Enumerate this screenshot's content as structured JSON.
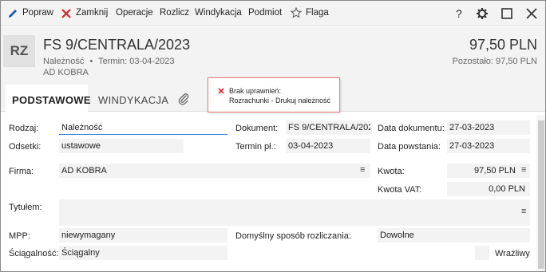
{
  "toolbar": {
    "items": [
      {
        "label": "Popraw",
        "icon": "pencil-icon"
      },
      {
        "label": "Zamknij",
        "icon": "close-x-icon"
      },
      {
        "label": "Operacje"
      },
      {
        "label": "Rozlicz"
      },
      {
        "label": "Windykacja"
      },
      {
        "label": "Podmiot"
      },
      {
        "label": "Flaga",
        "icon": "star-icon"
      }
    ],
    "window_buttons": [
      "help-icon",
      "settings-icon",
      "maximize-icon",
      "close-icon"
    ],
    "help": "?",
    "colors": {
      "pencil": "#1a5fb4",
      "close": "#d62828"
    }
  },
  "header": {
    "badge": "RZ",
    "title": "FS 9/CENTRALA/2023",
    "type": "Należność",
    "separator": "•",
    "term": "Termin: 03-04-2023",
    "contractor": "AD KOBRA",
    "amount": "97,50 PLN",
    "remaining": "Pozostało: 97,50 PLN"
  },
  "tabs": [
    {
      "label": "PODSTAWOWE",
      "active": true
    },
    {
      "label": "WINDYKACJA",
      "active": false
    }
  ],
  "tooltip": {
    "icon": "error-x-icon",
    "line1": "Brak uprawnień:",
    "line2": "Rozrachunki - Drukuj należność"
  },
  "form": {
    "rodzaj_label": "Rodzaj:",
    "rodzaj_value": "Należność",
    "odsetki_label": "Odsetki:",
    "odsetki_value": "ustawowe",
    "dokument_label": "Dokument:",
    "dokument_value": "FS 9/CENTRALA/2023",
    "termin_label": "Termin pł.:",
    "termin_value": "03-04-2023",
    "data_dok_label": "Data dokumentu:",
    "data_dok_value": "27-03-2023",
    "data_pow_label": "Data powstania:",
    "data_pow_value": "27-03-2023",
    "firma_label": "Firma:",
    "firma_value": "AD KOBRA",
    "kwota_label": "Kwota:",
    "kwota_value": "97,50 PLN",
    "kwota_vat_label": "Kwota VAT:",
    "kwota_vat_value": "0,00 PLN",
    "tytulem_label": "Tytułem:",
    "tytulem_value": "",
    "mpp_label": "MPP:",
    "mpp_value": "niewymagany",
    "sposob_label": "Domyślny sposób rozliczania:",
    "sposob_value": "Dowolne",
    "sciagalnosc_label": "Ściągalność:",
    "sciagalnosc_value": "Ściągalny",
    "wrazliwy_label": "Wrażliwy",
    "menu_glyph": "≡"
  }
}
